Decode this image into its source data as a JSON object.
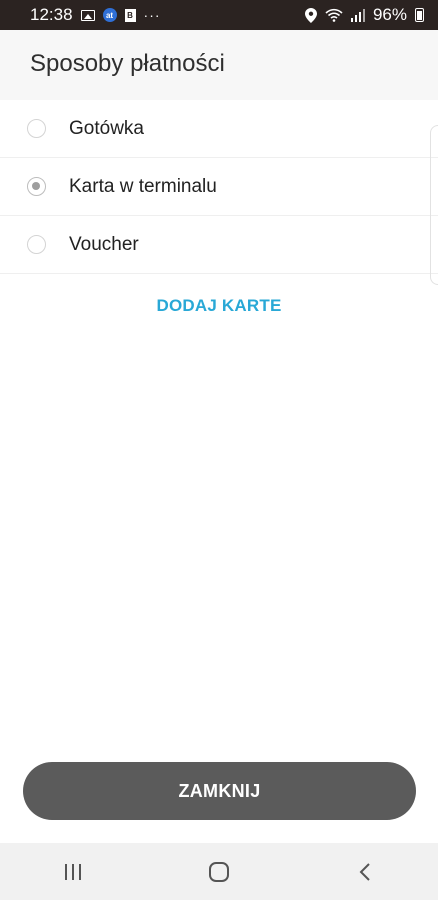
{
  "status_bar": {
    "time": "12:38",
    "battery": "96%",
    "icons": [
      "image-icon",
      "app-notification-icon",
      "document-icon",
      "more-icon",
      "location-icon",
      "wifi-icon",
      "signal-icon",
      "battery-icon"
    ],
    "app_icon_text": "at",
    "doc_icon_text": "B",
    "more": "···"
  },
  "header": {
    "title": "Sposoby płatności"
  },
  "payment_methods": [
    {
      "label": "Gotówka",
      "selected": false
    },
    {
      "label": "Karta w terminalu",
      "selected": true
    },
    {
      "label": "Voucher",
      "selected": false
    }
  ],
  "add_card_label": "DODAJ KARTE",
  "close_label": "ZAMKNIJ",
  "nav_bar": {
    "icons": [
      "recent-apps-icon",
      "home-icon",
      "back-icon"
    ]
  },
  "colors": {
    "accent": "#29a8d6",
    "button": "#5b5b5b",
    "status_bar": "#2b2321"
  }
}
